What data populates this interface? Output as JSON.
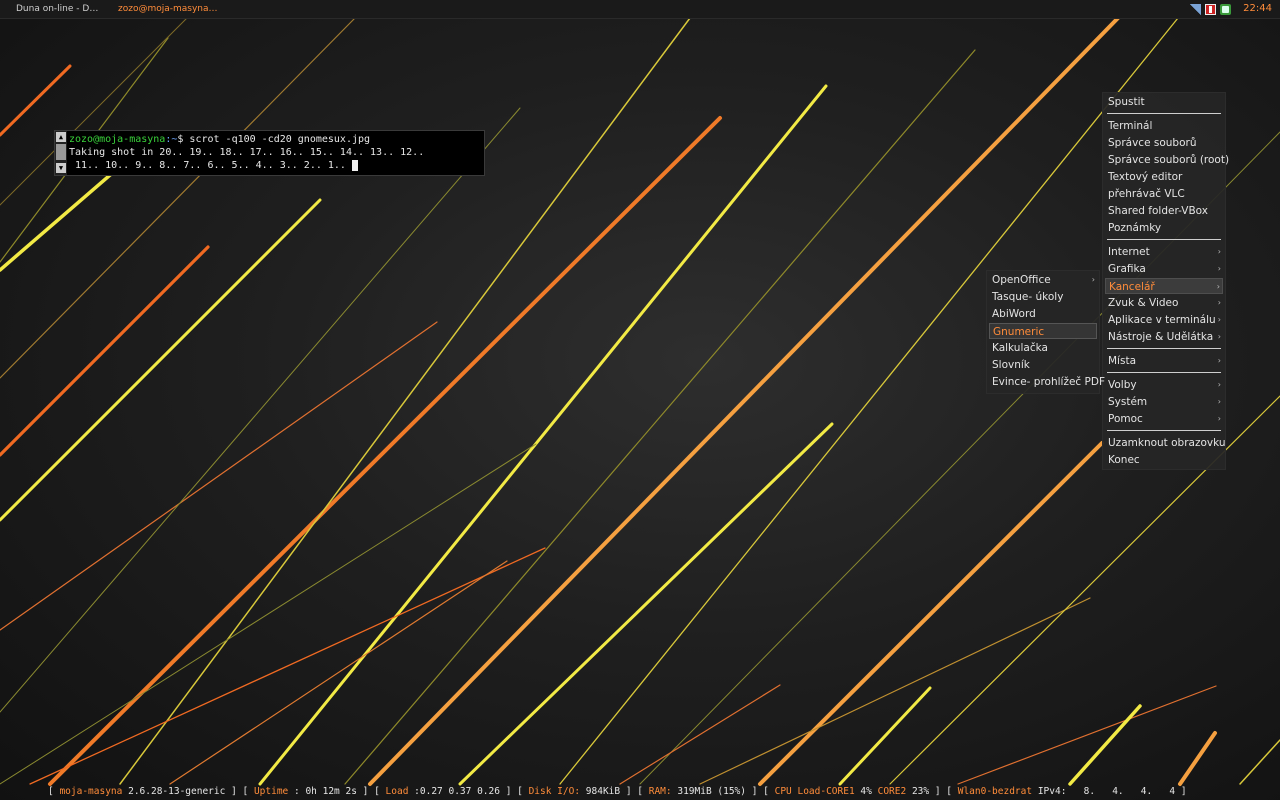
{
  "taskbar": {
    "tasks": [
      "Duna on-line - D…",
      "zozo@moja-masyna…"
    ],
    "tray_icons": [
      "signal-icon",
      "network-monitor-icon",
      "update-icon"
    ],
    "clock": "22:44"
  },
  "terminal": {
    "user_host": "zozo@moja-masyna",
    "path": ":~",
    "prompt": "$ ",
    "command": "scrot -q100 -cd20 gnomesux.jpg",
    "output_line1": "Taking shot in 20.. 19.. 18.. 17.. 16.. 15.. 14.. 13.. 12..",
    "output_line2": " 11.. 10.. 9.. 8.. 7.. 6.. 5.. 4.. 3.. 2.. 1.. "
  },
  "root_menu": {
    "items": [
      {
        "label": "Spustit"
      },
      {
        "label": "Terminál"
      },
      {
        "label": "Správce souborů"
      },
      {
        "label": "Správce souborů (root)"
      },
      {
        "label": "Textový editor"
      },
      {
        "label": "přehrávač VLC"
      },
      {
        "label": "Shared folder-VBox"
      },
      {
        "label": "Poznámky"
      },
      {
        "label": "Internet"
      },
      {
        "label": "Grafika"
      },
      {
        "label": "Kancelář"
      },
      {
        "label": "Zvuk & Video"
      },
      {
        "label": "Aplikace v terminálu"
      },
      {
        "label": "Nástroje & Udělátka"
      },
      {
        "label": "Místa"
      },
      {
        "label": "Volby"
      },
      {
        "label": "Systém"
      },
      {
        "label": "Pomoc"
      },
      {
        "label": "Uzamknout obrazovku"
      },
      {
        "label": "Konec"
      }
    ],
    "active_item": "Kancelář"
  },
  "sub_menu": {
    "items": [
      {
        "label": "OpenOffice"
      },
      {
        "label": "Tasque- úkoly"
      },
      {
        "label": "AbiWord"
      },
      {
        "label": "Gnumeric"
      },
      {
        "label": "Kalkulačka"
      },
      {
        "label": "Slovník"
      },
      {
        "label": "Evince- prohlížeč PDF"
      }
    ],
    "active_item": "Gnumeric"
  },
  "statusbar": {
    "hostname": "moja-masyna",
    "kernel": "2.6.28-13-generic",
    "uptime_label": "Uptime",
    "uptime_value": "0h 12m 2s",
    "load_label": "Load",
    "load_value": "0.27 0.37 0.26",
    "disk_label": "Disk I/O:",
    "disk_value": "984KiB",
    "ram_label": "RAM:",
    "ram_value": "319MiB (15%)",
    "cpu_label": "CPU Load-CORE1",
    "core1_value": "4%",
    "core2_label": "CORE2",
    "core2_value": "23%",
    "wlan_label": "Wlan0-bezdrat",
    "ipv4_label": "IPv4:",
    "ipv4_value": "8.   4.   4.   4"
  },
  "colors": {
    "accent_orange": "#ff8c3a",
    "terminal_user_green": "#39d13a",
    "wallpaper_yellow": "#f2ea45",
    "wallpaper_orange": "#f06a22"
  }
}
